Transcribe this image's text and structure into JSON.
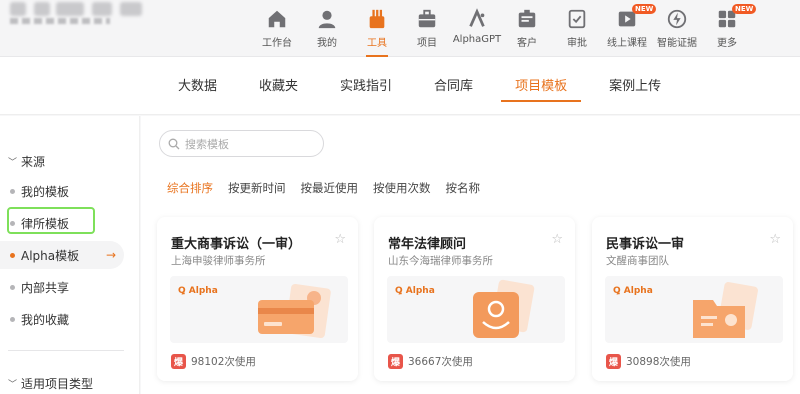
{
  "nav": {
    "items": [
      {
        "label": "工作台",
        "icon": "home-icon"
      },
      {
        "label": "我的",
        "icon": "user-icon"
      },
      {
        "label": "工具",
        "icon": "tools-icon",
        "active": true
      },
      {
        "label": "项目",
        "icon": "briefcase-icon"
      },
      {
        "label": "AlphaGPT",
        "icon": "alphagpt-icon"
      },
      {
        "label": "客户",
        "icon": "client-icon"
      },
      {
        "label": "审批",
        "icon": "approval-icon"
      },
      {
        "label": "线上课程",
        "icon": "video-icon",
        "badge": "NEW"
      },
      {
        "label": "智能证据",
        "icon": "lightning-icon"
      },
      {
        "label": "更多",
        "icon": "grid-icon",
        "badge": "NEW"
      }
    ]
  },
  "subnav": {
    "tabs": [
      {
        "label": "大数据"
      },
      {
        "label": "收藏夹"
      },
      {
        "label": "实践指引"
      },
      {
        "label": "合同库"
      },
      {
        "label": "项目模板",
        "active": true
      },
      {
        "label": "案例上传"
      }
    ]
  },
  "sidebar": {
    "source_heading": "来源",
    "items": [
      {
        "label": "我的模板"
      },
      {
        "label": "律所模板"
      },
      {
        "label": "Alpha模板",
        "active": true
      },
      {
        "label": "内部共享"
      },
      {
        "label": "我的收藏"
      }
    ],
    "type_heading": "适用项目类型"
  },
  "search": {
    "placeholder": "搜索模板"
  },
  "sorts": [
    {
      "label": "综合排序",
      "active": true
    },
    {
      "label": "按更新时间"
    },
    {
      "label": "按最近使用"
    },
    {
      "label": "按使用次数"
    },
    {
      "label": "按名称"
    }
  ],
  "cards": [
    {
      "title": "重大商事诉讼（一审）",
      "org": "上海申骏律师事务所",
      "brand": "Alpha",
      "hot": "爆",
      "usage": "98102次使用"
    },
    {
      "title": "常年法律顾问",
      "org": "山东今海瑞律师事务所",
      "brand": "Alpha",
      "hot": "爆",
      "usage": "36667次使用"
    },
    {
      "title": "民事诉讼一审",
      "org": "文醒商事团队",
      "brand": "Alpha",
      "hot": "爆",
      "usage": "30898次使用"
    }
  ],
  "colors": {
    "accent": "#e8731e",
    "hot": "#e8554a",
    "highlight": "#7ee05a"
  }
}
